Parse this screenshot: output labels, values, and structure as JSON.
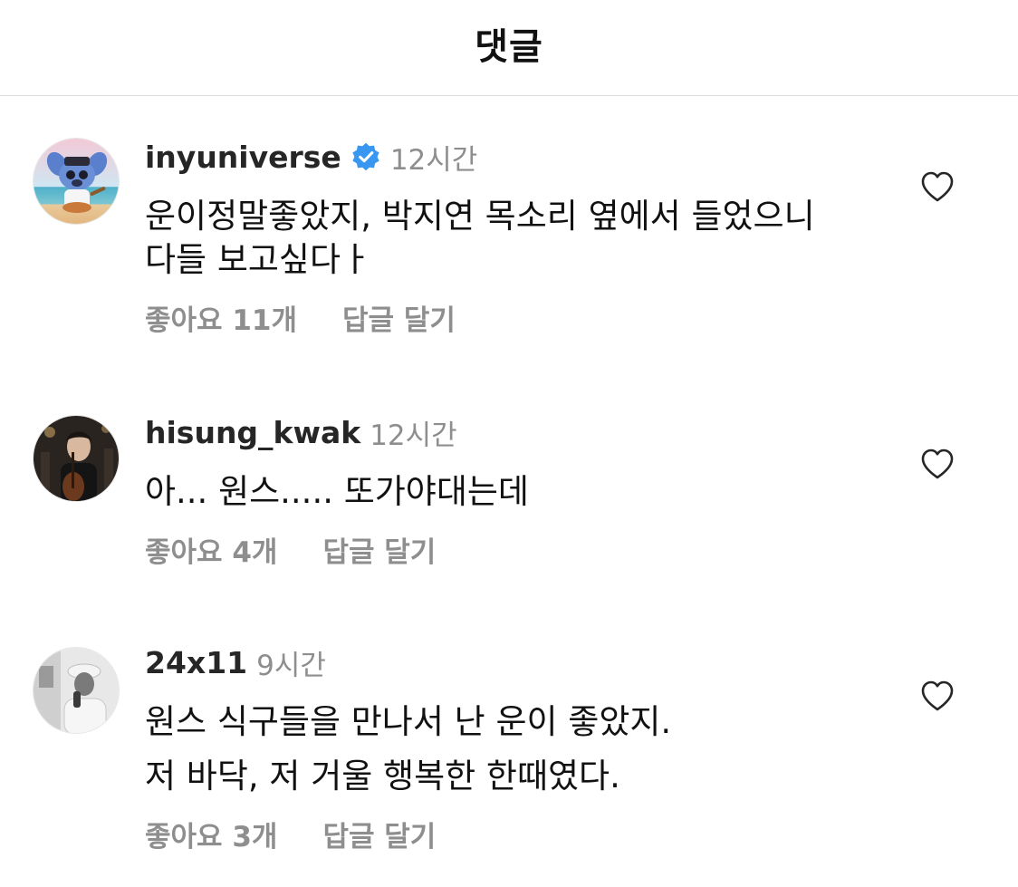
{
  "header": {
    "title": "댓글"
  },
  "comments": [
    {
      "username": "inyuniverse",
      "verified": true,
      "time": "12시간",
      "lines": [
        "운이정말좋았지, 박지연 목소리 옆에서 들었으니",
        "다들 보고싶다ㅏ"
      ],
      "likes": "좋아요 11개",
      "reply": "답글 달기"
    },
    {
      "username": "hisung_kwak",
      "verified": false,
      "time": "12시간",
      "lines": [
        "아... 원스..... 또가야대는데"
      ],
      "likes": "좋아요 4개",
      "reply": "답글 달기"
    },
    {
      "username": "24x11",
      "verified": false,
      "time": "9시간",
      "lines": [
        "원스 식구들을 만나서 난 운이 좋았지.",
        "저 바닥, 저 거울 행복한 한때였다."
      ],
      "likes": "좋아요 3개",
      "reply": "답글 달기"
    }
  ],
  "icons": {
    "verified": "verified-badge-icon",
    "like": "heart-outline-icon"
  },
  "colors": {
    "verified_blue": "#3897f0",
    "muted_gray": "#8e8e8e",
    "divider": "#dcdcdc"
  }
}
